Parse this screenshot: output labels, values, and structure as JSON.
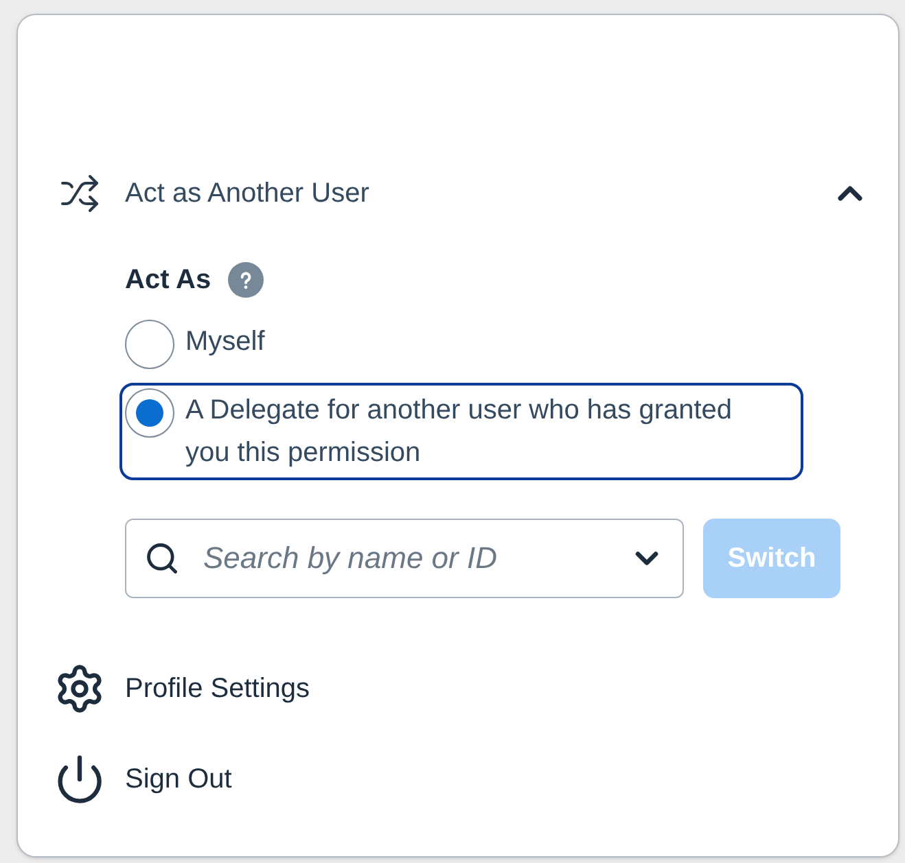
{
  "section": {
    "title": "Act as Another User",
    "expanded": true
  },
  "act_as": {
    "label": "Act As",
    "options": [
      {
        "label": "Myself",
        "selected": false
      },
      {
        "label": "A Delegate for another user who has granted you this permission",
        "selected": true
      }
    ]
  },
  "search": {
    "placeholder": "Search by name or ID"
  },
  "switch_button": {
    "label": "Switch",
    "disabled": true
  },
  "menu_items": [
    {
      "kind": "settings",
      "label": "Profile Settings"
    },
    {
      "kind": "power",
      "label": "Sign Out"
    }
  ]
}
